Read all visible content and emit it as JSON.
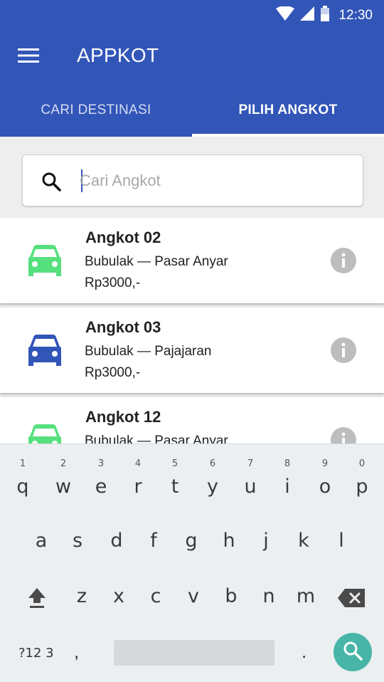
{
  "status_bar": {
    "time": "12:30"
  },
  "app_bar": {
    "title": "APPKOT",
    "menu_icon": "hamburger-menu-icon"
  },
  "tabs": [
    {
      "label": "CARI DESTINASI",
      "active": false
    },
    {
      "label": "PILIH ANGKOT",
      "active": true
    }
  ],
  "search": {
    "placeholder": "Cari Angkot",
    "value": ""
  },
  "angkot_list": [
    {
      "name": "Angkot 02",
      "route": "Bubulak — Pasar Anyar",
      "price": "Rp3000,-",
      "car_color": "#55e07d"
    },
    {
      "name": "Angkot 03",
      "route": "Bubulak — Pajajaran",
      "price": "Rp3000,-",
      "car_color": "#3255b8"
    },
    {
      "name": "Angkot 12",
      "route": "Bubulak — Pasar Anyar",
      "price": "",
      "car_color": "#55e07d"
    }
  ],
  "keyboard": {
    "row1": [
      {
        "k": "q",
        "n": "1"
      },
      {
        "k": "w",
        "n": "2"
      },
      {
        "k": "e",
        "n": "3"
      },
      {
        "k": "r",
        "n": "4"
      },
      {
        "k": "t",
        "n": "5"
      },
      {
        "k": "y",
        "n": "6"
      },
      {
        "k": "u",
        "n": "7"
      },
      {
        "k": "i",
        "n": "8"
      },
      {
        "k": "o",
        "n": "9"
      },
      {
        "k": "p",
        "n": "0"
      }
    ],
    "row2": [
      "a",
      "s",
      "d",
      "f",
      "g",
      "h",
      "j",
      "k",
      "l"
    ],
    "row3": [
      "z",
      "x",
      "c",
      "v",
      "b",
      "n",
      "m"
    ],
    "symbols_label": "?12 3",
    "comma": ",",
    "period": "."
  },
  "colors": {
    "primary": "#3255b8",
    "accent_green": "#55e07d",
    "fab": "#47b6a8"
  }
}
